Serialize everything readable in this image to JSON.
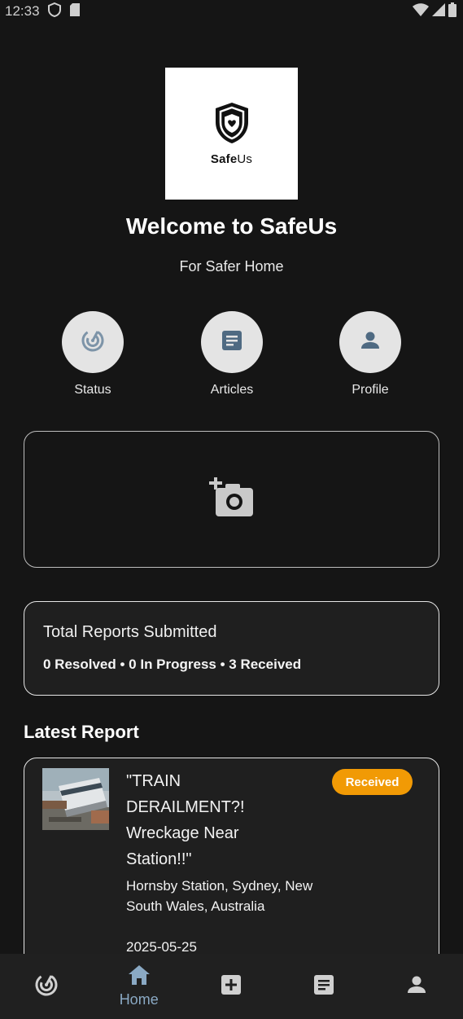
{
  "status_bar": {
    "time": "12:33"
  },
  "logo": {
    "brand_bold": "Safe",
    "brand_light": "Us"
  },
  "welcome": {
    "title": "Welcome to SafeUs",
    "subtitle": "For Safer Home"
  },
  "quick_actions": [
    {
      "label": "Status",
      "icon": "radar-icon"
    },
    {
      "label": "Articles",
      "icon": "article-icon"
    },
    {
      "label": "Profile",
      "icon": "person-icon"
    }
  ],
  "camera_card": {
    "icon": "add-photo-icon"
  },
  "summary": {
    "title": "Total Reports Submitted",
    "stats": "0 Resolved • 0 In Progress • 3 Received"
  },
  "latest": {
    "title": "Latest Report",
    "report": {
      "title": "\"TRAIN DERAILMENT?! Wreckage Near Station!!\"",
      "location": "Hornsby Station, Sydney, New South Wales, Australia",
      "date": "2025-05-25",
      "status": "Received",
      "status_color": "#f19a05"
    }
  },
  "bottom_nav": [
    {
      "name": "status",
      "label": "",
      "icon": "radar-icon"
    },
    {
      "name": "home",
      "label": "Home",
      "icon": "home-icon",
      "active": true
    },
    {
      "name": "add",
      "label": "",
      "icon": "add-box-icon"
    },
    {
      "name": "articles",
      "label": "",
      "icon": "article-icon"
    },
    {
      "name": "profile",
      "label": "",
      "icon": "person-icon"
    }
  ],
  "colors": {
    "background": "#151515",
    "accent": "#8aa9c4",
    "badge": "#f19a05"
  }
}
